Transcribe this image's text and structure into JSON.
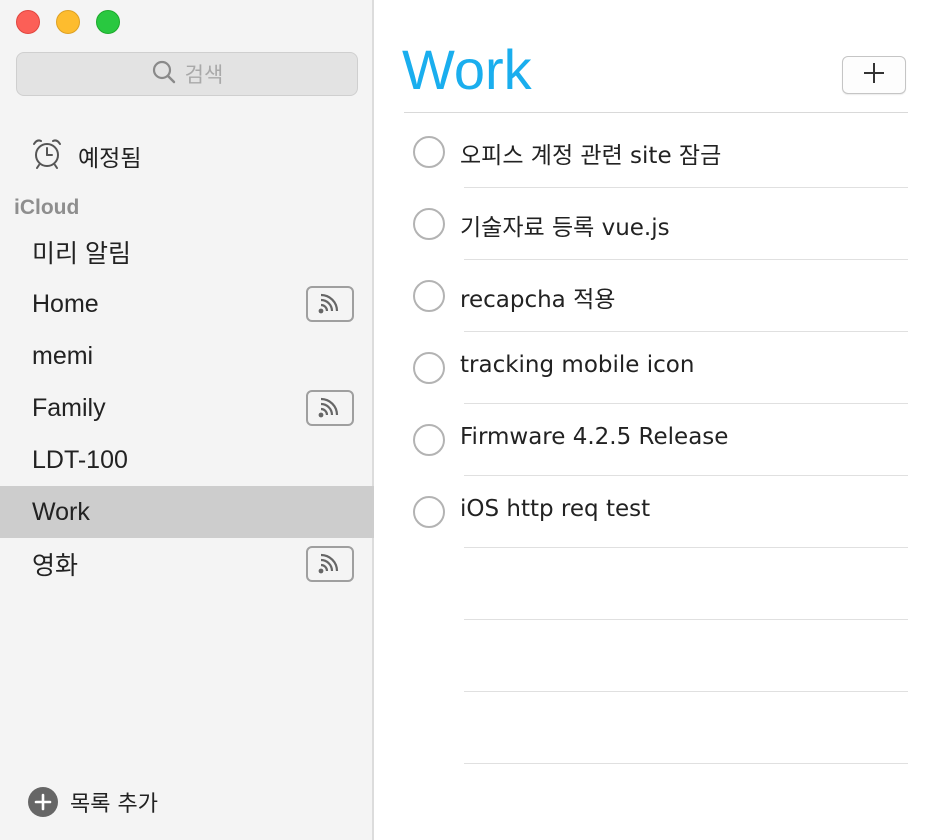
{
  "window": {
    "controls": [
      "close",
      "minimize",
      "maximize"
    ]
  },
  "sidebar": {
    "search_placeholder": "검색",
    "scheduled_label": "예정됨",
    "section_label": "iCloud",
    "items": [
      {
        "label": "미리 알림",
        "shared": false
      },
      {
        "label": "Home",
        "shared": true
      },
      {
        "label": "memi",
        "shared": false
      },
      {
        "label": "Family",
        "shared": true
      },
      {
        "label": "LDT-100",
        "shared": false
      },
      {
        "label": "Work",
        "shared": false,
        "selected": true
      },
      {
        "label": "영화",
        "shared": true
      }
    ],
    "add_list_label": "목록 추가"
  },
  "main": {
    "title": "Work",
    "title_color": "#1aaeee",
    "tasks": [
      {
        "text": "오피스 계정 관련 site 잠금"
      },
      {
        "text": "기술자료 등록 vue.js"
      },
      {
        "text": "recapcha 적용"
      },
      {
        "text": "tracking mobile icon"
      },
      {
        "text": "Firmware 4.2.5 Release"
      },
      {
        "text": "iOS http req test"
      }
    ],
    "empty_rows": 3
  }
}
